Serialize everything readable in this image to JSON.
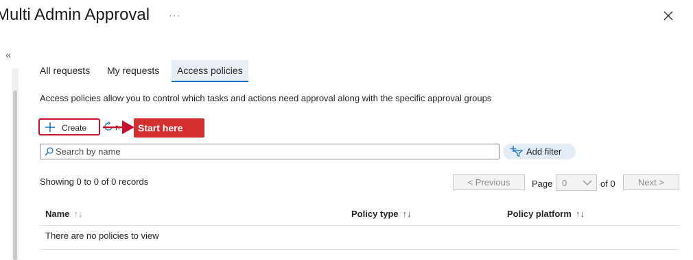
{
  "header": {
    "title": "Multi Admin Approval",
    "more_label": "···",
    "close_icon": "close-icon"
  },
  "nav": {
    "collapse_label": "«"
  },
  "tabs": [
    {
      "label": "All requests",
      "active": false
    },
    {
      "label": "My requests",
      "active": false
    },
    {
      "label": "Access policies",
      "active": true
    }
  ],
  "description": "Access policies allow you to control which tasks and actions need approval along with the specific approval groups",
  "toolbar": {
    "create_label": "Create",
    "create_icon": "plus-icon",
    "refresh_icon": "refresh-icon",
    "refresh_label_fragment": "re"
  },
  "annotation": {
    "callout_text": "Start here",
    "callout_color": "#d32f2f"
  },
  "search": {
    "placeholder": "Search by name",
    "value": ""
  },
  "filter": {
    "label": "Add filter",
    "icon": "add-filter-icon"
  },
  "pagination": {
    "records_text": "Showing 0 to 0 of 0 records",
    "previous_label": "< Previous",
    "page_label": "Page",
    "page_value": "0",
    "of_label": "of 0",
    "next_label": "Next >"
  },
  "table": {
    "columns": [
      {
        "label": "Name",
        "sort_icon": "↑↓"
      },
      {
        "label": "Policy type",
        "sort_icon": "↑↓"
      },
      {
        "label": "Policy platform",
        "sort_icon": "↑↓"
      }
    ],
    "empty_text": "There are no policies to view"
  },
  "colors": {
    "accent": "#0f6cbd",
    "highlight_border": "#c8102e",
    "filter_bg": "#e3ecf7"
  }
}
